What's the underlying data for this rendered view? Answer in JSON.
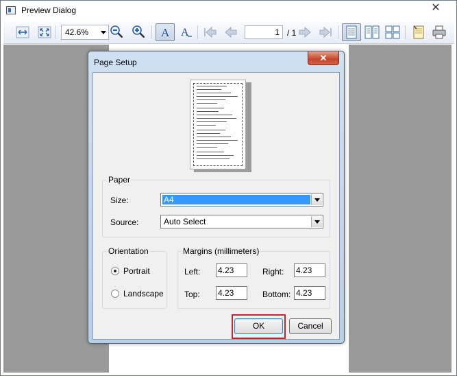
{
  "window": {
    "title": "Preview Dialog",
    "close_glyph": "✕"
  },
  "toolbar": {
    "zoom_value": "42.6%",
    "page_current": "1",
    "page_total": "/ 1",
    "icons": [
      "fit-width-icon",
      "fit-page-icon",
      "zoom-out-icon",
      "zoom-in-icon",
      "font-a-icon",
      "font-a-dropdown-icon",
      "first-page-icon",
      "prev-page-icon",
      "next-page-icon",
      "last-page-icon",
      "single-page-icon",
      "two-page-icon",
      "four-page-icon",
      "page-setup-icon",
      "print-icon"
    ]
  },
  "dialog": {
    "title": "Page Setup",
    "close_glyph": "✕",
    "paper": {
      "group_label": "Paper",
      "size_label": "Size:",
      "size_value": "A4",
      "source_label": "Source:",
      "source_value": "Auto Select"
    },
    "orientation": {
      "group_label": "Orientation",
      "portrait_label": "Portrait",
      "landscape_label": "Landscape",
      "selected": "Portrait"
    },
    "margins": {
      "group_label": "Margins (millimeters)",
      "left_label": "Left:",
      "left_value": "4.23",
      "right_label": "Right:",
      "right_value": "4.23",
      "top_label": "Top:",
      "top_value": "4.23",
      "bottom_label": "Bottom:",
      "bottom_value": "4.23"
    },
    "ok_label": "OK",
    "cancel_label": "Cancel"
  },
  "colors": {
    "preview_background": "#9a9a9a",
    "highlight_outline": "#c1272d",
    "selection": "#3399ff",
    "dialog_frame": "#b8cfe8"
  }
}
